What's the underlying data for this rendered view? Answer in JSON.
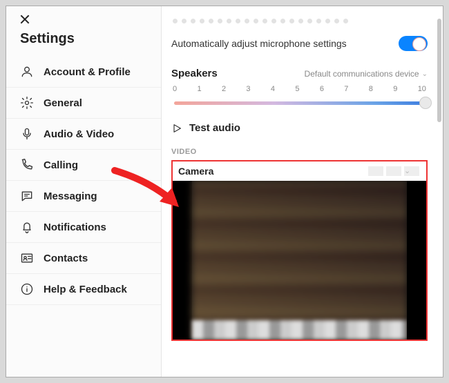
{
  "sidebar": {
    "title": "Settings",
    "items": [
      {
        "label": "Account & Profile",
        "icon": "person-icon"
      },
      {
        "label": "General",
        "icon": "gear-icon"
      },
      {
        "label": "Audio & Video",
        "icon": "microphone-icon"
      },
      {
        "label": "Calling",
        "icon": "phone-icon"
      },
      {
        "label": "Messaging",
        "icon": "message-icon"
      },
      {
        "label": "Notifications",
        "icon": "bell-icon"
      },
      {
        "label": "Contacts",
        "icon": "contact-card-icon"
      },
      {
        "label": "Help & Feedback",
        "icon": "info-icon"
      }
    ]
  },
  "main": {
    "auto_mic_label": "Automatically adjust microphone settings",
    "auto_mic_on": true,
    "speakers": {
      "title": "Speakers",
      "device": "Default communications device",
      "ticks": [
        "0",
        "1",
        "2",
        "3",
        "4",
        "5",
        "6",
        "7",
        "8",
        "9",
        "10"
      ],
      "value": 10
    },
    "test_audio_label": "Test audio",
    "video_section_label": "VIDEO",
    "camera": {
      "title": "Camera"
    }
  },
  "colors": {
    "accent": "#0a84ff",
    "highlight_border": "#e33"
  }
}
